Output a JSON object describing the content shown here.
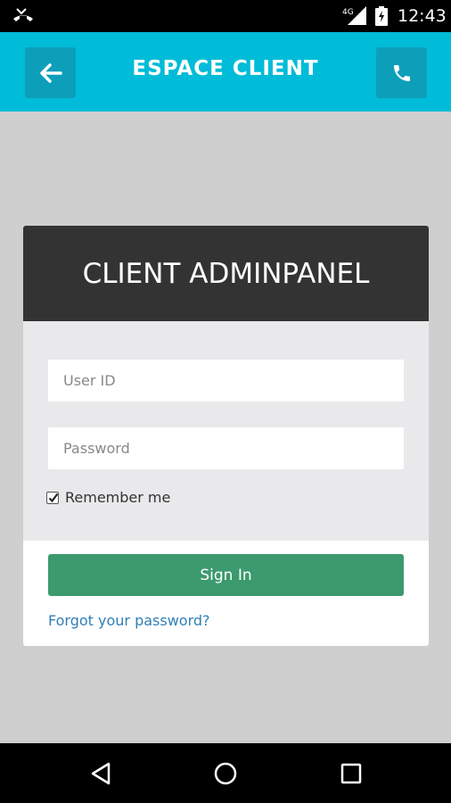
{
  "status_bar": {
    "time": "12:43",
    "network": "4G",
    "icons": [
      "missed-call-icon",
      "signal-icon",
      "battery-icon"
    ]
  },
  "app_bar": {
    "title": "ESPACE CLIENT",
    "back_icon": "arrow-left-icon",
    "call_icon": "phone-icon",
    "color": "#00bcd8"
  },
  "card": {
    "title": "CLIENT ADMINPANEL",
    "user_placeholder": "User ID",
    "password_placeholder": "Password",
    "user_value": "",
    "password_value": "",
    "remember_label": "Remember me",
    "remember_checked": true,
    "signin_label": "Sign In",
    "forgot_link": "Forgot your password?",
    "signin_color": "#3c9a6e",
    "link_color": "#2f7fb5"
  },
  "nav_bar": {
    "icons": [
      "nav-back-icon",
      "nav-home-icon",
      "nav-recents-icon"
    ]
  }
}
